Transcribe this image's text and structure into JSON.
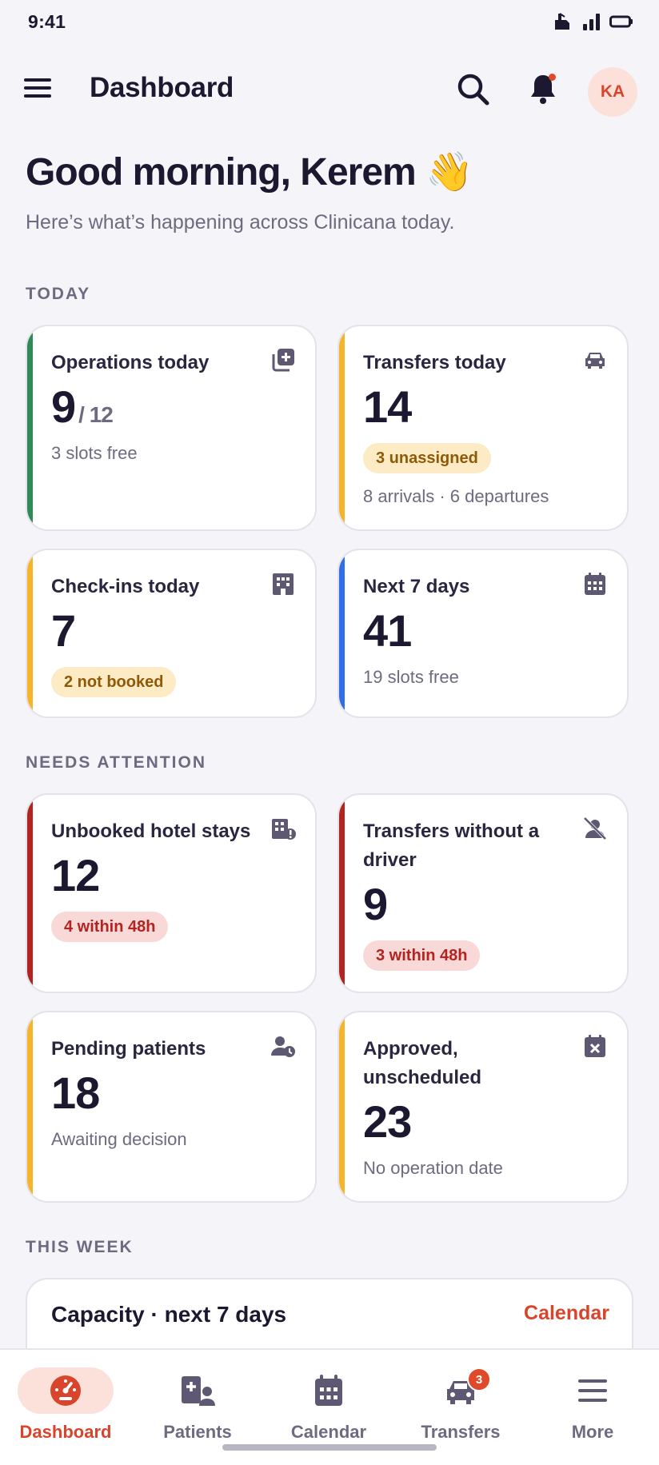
{
  "status_bar": {
    "time": "9:41"
  },
  "header": {
    "title": "Dashboard",
    "avatar_initials": "KA"
  },
  "greeting": {
    "title": "Good morning, Kerem 👋",
    "subtitle": "Here’s what’s happening across Clinicana today."
  },
  "sections": {
    "today": "TODAY",
    "attention": "NEEDS ATTENTION",
    "week": "THIS WEEK"
  },
  "today_cards": {
    "operations": {
      "title": "Operations today",
      "value": "9",
      "total": "/ 12",
      "sub": "3 slots free",
      "accent": "#2E8B57"
    },
    "transfers": {
      "title": "Transfers today",
      "value": "14",
      "badge": "3 unassigned",
      "sub": "8 arrivals · 6 departures",
      "accent": "#F5B42A"
    },
    "checkins": {
      "title": "Check-ins today",
      "value": "7",
      "badge": "2 not booked",
      "accent": "#F5B42A"
    },
    "next7": {
      "title": "Next 7 days",
      "value": "41",
      "sub": "19 slots free",
      "accent": "#2F6FEB"
    }
  },
  "attention_cards": {
    "hotel": {
      "title": "Unbooked hotel stays",
      "value": "12",
      "badge": "4 within 48h",
      "accent": "#B3231F"
    },
    "driver": {
      "title": "Transfers without a driver",
      "value": "9",
      "badge": "3 within 48h",
      "accent": "#B3231F"
    },
    "pending": {
      "title": "Pending patients",
      "value": "18",
      "sub": "Awaiting decision",
      "accent": "#F5B42A"
    },
    "approved": {
      "title": "Approved, unscheduled",
      "value": "23",
      "sub": "No operation date",
      "accent": "#F5B42A"
    }
  },
  "capacity": {
    "title": "Capacity · next 7 days",
    "link": "Calendar"
  },
  "bottom_nav": {
    "items": [
      {
        "label": "Dashboard",
        "icon": "gauge-icon",
        "active": true
      },
      {
        "label": "Patients",
        "icon": "patients-icon"
      },
      {
        "label": "Calendar",
        "icon": "calendar-icon"
      },
      {
        "label": "Transfers",
        "icon": "car-icon",
        "badge": "3"
      },
      {
        "label": "More",
        "icon": "menu-icon"
      }
    ]
  },
  "colors": {
    "brand": "#D8452C",
    "background": "#F5F4F8",
    "text": "#1B1830",
    "muted": "#6E6A80"
  }
}
